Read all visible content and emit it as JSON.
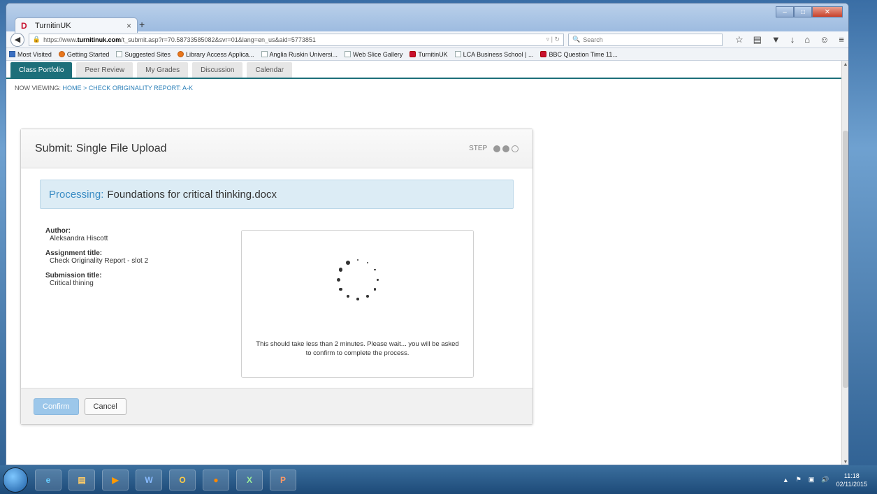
{
  "browser": {
    "tab_title": "TurnitinUK",
    "tab_favicon": "D",
    "close_glyph": "×",
    "newtab_glyph": "+",
    "url_prefix": "https://www.",
    "url_host": "turnitinuk.com",
    "url_rest": "/t_submit.asp?r=70.58733585082&svr=01&lang=en_us&aid=5773851",
    "search_placeholder": "Search",
    "bookmarks": [
      {
        "label": "Most Visited"
      },
      {
        "label": "Getting Started"
      },
      {
        "label": "Suggested Sites"
      },
      {
        "label": "Library Access Applica..."
      },
      {
        "label": "Anglia Ruskin Universi..."
      },
      {
        "label": "Web Slice Gallery"
      },
      {
        "label": "TurnitinUK"
      },
      {
        "label": "LCA Business School | ..."
      },
      {
        "label": "BBC Question Time 11..."
      }
    ]
  },
  "nav_tabs": [
    {
      "label": "Class Portfolio",
      "active": true
    },
    {
      "label": "Peer Review",
      "active": false
    },
    {
      "label": "My Grades",
      "active": false
    },
    {
      "label": "Discussion",
      "active": false
    },
    {
      "label": "Calendar",
      "active": false
    }
  ],
  "breadcrumb": {
    "prefix": "NOW VIEWING:",
    "home": "HOME",
    "separator": ">",
    "current": "CHECK ORIGINALITY REPORT: A-K"
  },
  "submit": {
    "title": "Submit: Single File Upload",
    "step_label": "STEP",
    "step_current": 2,
    "step_total": 3,
    "processing_label": "Processing:",
    "filename": "Foundations for critical thinking.docx",
    "author_label": "Author:",
    "author": "Aleksandra Hiscott",
    "assignment_label": "Assignment title:",
    "assignment": "Check Originality Report - slot 2",
    "submission_label": "Submission title:",
    "submission": "Critical thining",
    "wait_message": "This should take less than 2 minutes. Please wait... you will be asked to confirm to complete the process.",
    "confirm_label": "Confirm",
    "cancel_label": "Cancel"
  },
  "taskbar": {
    "clock_time": "11:18",
    "clock_date": "02/11/2015"
  }
}
